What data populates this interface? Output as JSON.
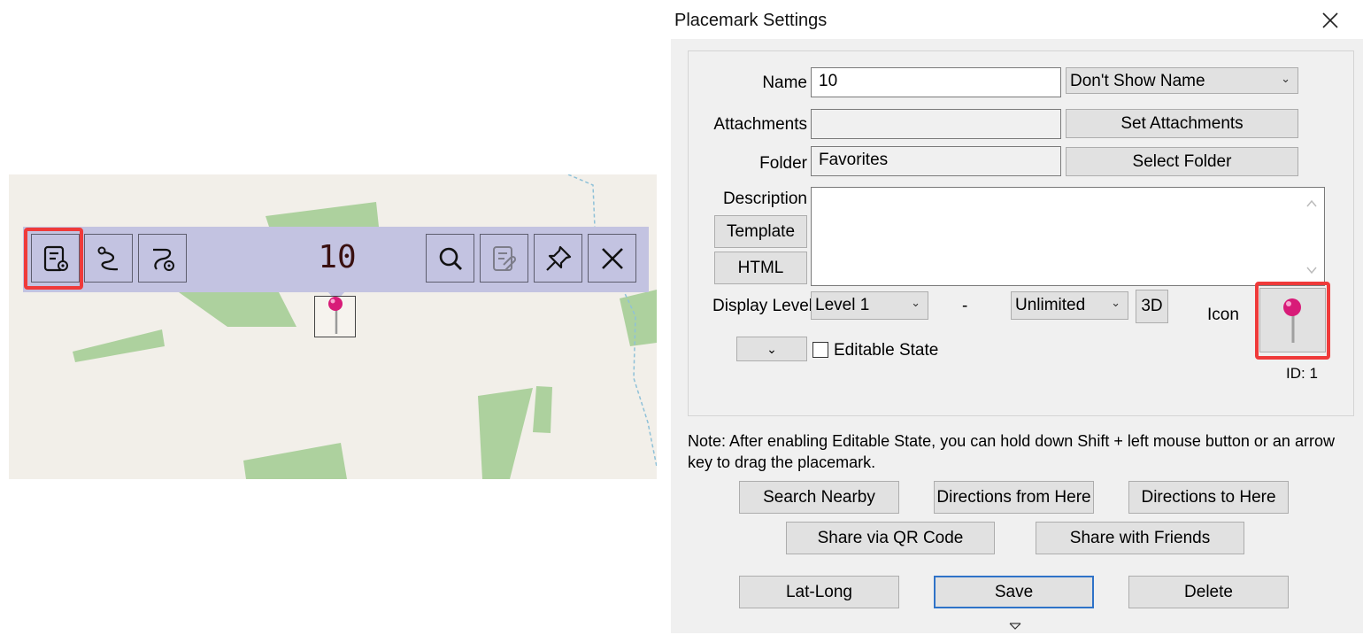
{
  "map_toolbar": {
    "title": "10",
    "buttons": [
      {
        "name": "placemark-settings-button",
        "icon": "placemark-settings-icon"
      },
      {
        "name": "route-button",
        "icon": "route-icon"
      },
      {
        "name": "route-point-button",
        "icon": "route-point-icon"
      },
      {
        "name": "search-button",
        "icon": "search-icon"
      },
      {
        "name": "attach-button",
        "icon": "attachment-note-icon",
        "disabled": true
      },
      {
        "name": "pin-button",
        "icon": "pushpin-icon"
      },
      {
        "name": "close-toolbar-button",
        "icon": "close-icon"
      }
    ],
    "highlight_color": "#ef3a3a"
  },
  "dialog": {
    "title": "Placemark Settings",
    "name_label": "Name",
    "name_value": "10",
    "name_display_option": "Don't Show Name",
    "attachments_label": "Attachments",
    "attachments_value": "",
    "set_attachments_label": "Set Attachments",
    "folder_label": "Folder",
    "folder_value": "Favorites",
    "select_folder_label": "Select Folder",
    "description_label": "Description",
    "description_value": "",
    "template_label": "Template",
    "html_label": "HTML",
    "display_level_label": "Display Level",
    "display_level_from": "Level 1",
    "display_level_separator": "-",
    "display_level_to": "Unlimited",
    "three_d_label": "3D",
    "icon_label": "Icon",
    "icon_id": "ID: 1",
    "editable_state_label": "Editable State",
    "editable_state_checked": false,
    "note": "Note: After enabling Editable State, you can hold down Shift + left mouse button or an arrow key to drag the placemark.",
    "buttons": {
      "search_nearby": "Search Nearby",
      "directions_from": "Directions from Here",
      "directions_to": "Directions to Here",
      "share_qr": "Share via QR Code",
      "share_friends": "Share with Friends",
      "lat_long": "Lat-Long",
      "save": "Save",
      "delete": "Delete"
    }
  }
}
